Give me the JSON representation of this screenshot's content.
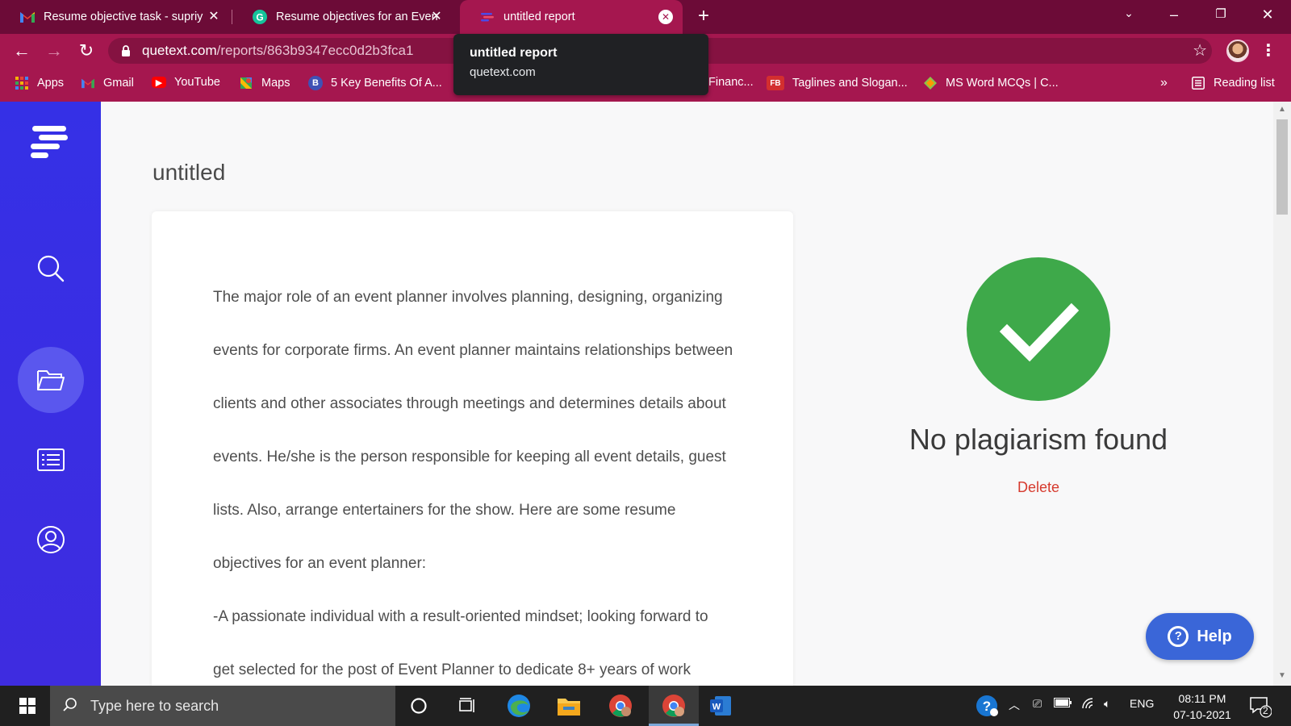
{
  "browser": {
    "tabs": [
      {
        "title": "Resume objective task - supriy",
        "favicon": "gmail-icon"
      },
      {
        "title": "Resume objectives for an Even",
        "favicon": "grammarly-icon"
      },
      {
        "title": "untitled report",
        "favicon": "quetext-icon",
        "active": true
      }
    ],
    "url_host": "quetext.com",
    "url_path": "/reports/863b9347ecc0d2b3fca1",
    "tooltip": {
      "title": "untitled report",
      "domain": "quetext.com"
    },
    "bookmarks": [
      {
        "label": "Apps",
        "icon": "apps-grid-icon"
      },
      {
        "label": "Gmail",
        "icon": "gmail-icon"
      },
      {
        "label": "YouTube",
        "icon": "youtube-icon"
      },
      {
        "label": "Maps",
        "icon": "maps-icon"
      },
      {
        "label": "5 Key Benefits Of A...",
        "icon": "site-icon"
      },
      {
        "label": "Financ...",
        "icon": "site-icon"
      },
      {
        "label": "Taglines and Slogan...",
        "icon": "fb-icon"
      },
      {
        "label": "MS Word MCQs | C...",
        "icon": "site-icon"
      }
    ],
    "overflow_label": "»",
    "reading_list": "Reading list"
  },
  "page": {
    "title": "untitled",
    "document_lines": [
      "The major role of an event planner involves planning, designing, organizing",
      "events for corporate firms. An event planner maintains relationships between",
      "clients and other associates through meetings and determines details about",
      "events. He/she is the person responsible for keeping all event details, guest",
      "lists. Also, arrange entertainers for the show. Here are some resume",
      "objectives for an event planner:",
      "-A passionate individual with a result-oriented mindset; looking forward to",
      "get selected for the post of Event Planner to dedicate 8+ years of work"
    ],
    "result": {
      "message": "No plagiarism found",
      "delete_label": "Delete",
      "status_color": "#3ea94a"
    },
    "help_label": "Help"
  },
  "taskbar": {
    "search_placeholder": "Type here to search",
    "tray_lang": "ENG",
    "time": "08:11 PM",
    "date": "07-10-2021",
    "notification_count": "2"
  }
}
